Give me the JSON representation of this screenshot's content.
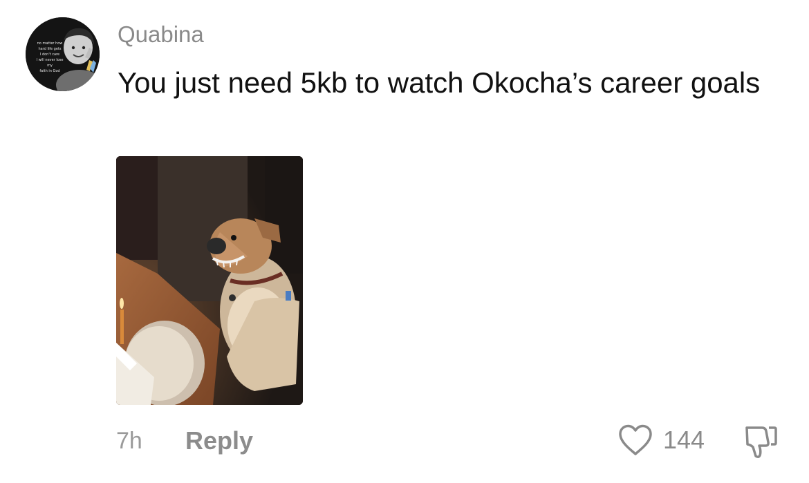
{
  "comment": {
    "username": "Quabina",
    "text": "You just need 5kb to watch Okocha’s career goals",
    "avatar": {
      "overlay_text": "no matter how\nhard life gets\nI don't care\nI will never lose\nmy\nfaith in God"
    },
    "media": {
      "description_icon": "dog-birthday-cake-photo"
    },
    "meta": {
      "time": "7h",
      "reply_label": "Reply",
      "like_count": "144"
    },
    "icons": {
      "like": "heart-outline-icon",
      "dislike": "thumbs-down-outline-icon"
    },
    "colors": {
      "primary_text": "#111111",
      "secondary_text": "#8a8a8a",
      "icon_stroke": "#8a8a8a"
    }
  }
}
